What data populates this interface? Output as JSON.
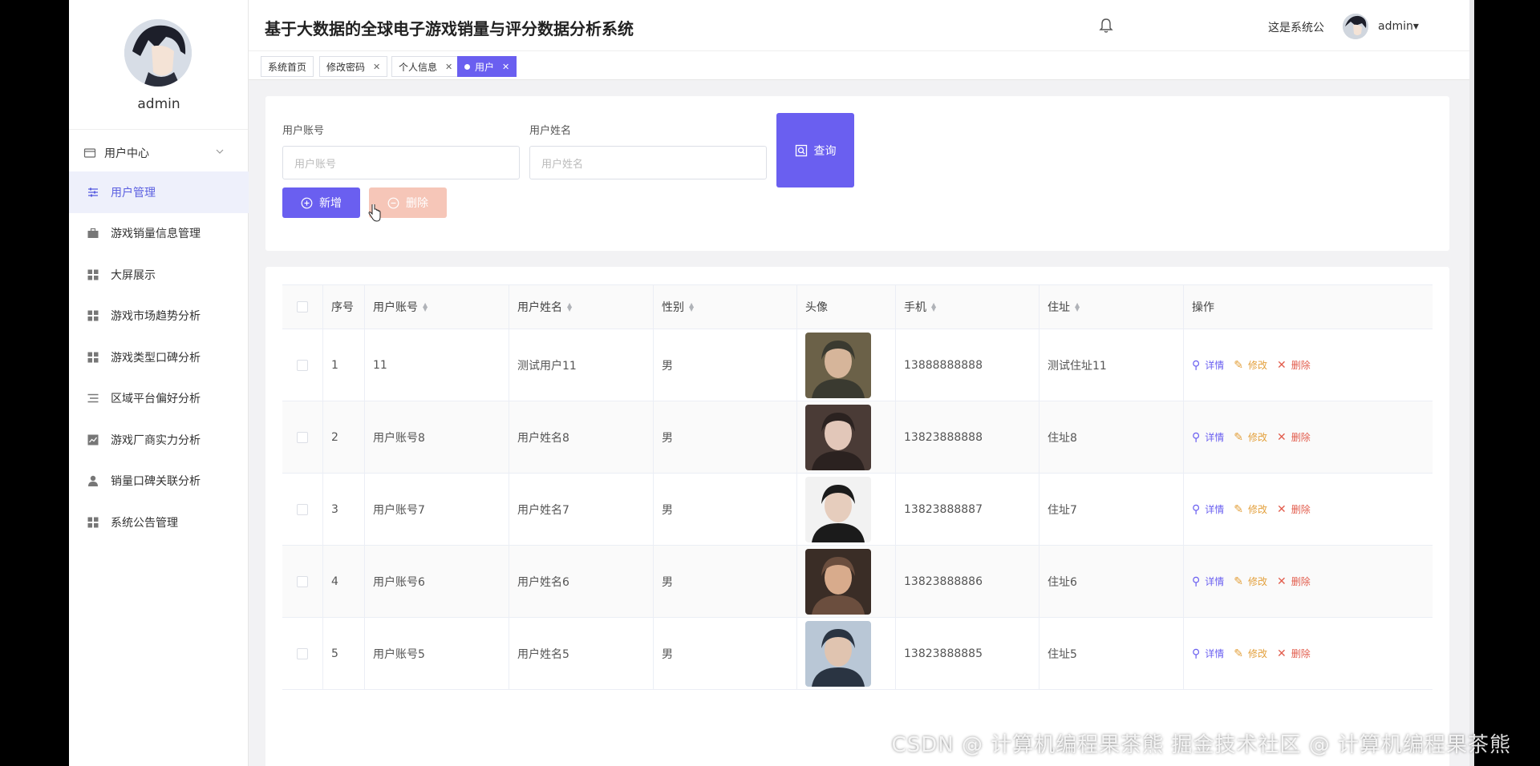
{
  "app": {
    "title": "基于大数据的全球电子游戏销量与评分数据分析系统"
  },
  "header": {
    "notice": "这是系统公",
    "user": "admin▾"
  },
  "sidebar": {
    "username": "admin",
    "group": "用户中心",
    "items": [
      {
        "label": "用户管理",
        "icon": "sliders-icon"
      },
      {
        "label": "游戏销量信息管理",
        "icon": "briefcase-icon"
      },
      {
        "label": "大屏展示",
        "icon": "grid-icon"
      },
      {
        "label": "游戏市场趋势分析",
        "icon": "grid-icon"
      },
      {
        "label": "游戏类型口碑分析",
        "icon": "grid-icon"
      },
      {
        "label": "区域平台偏好分析",
        "icon": "list-icon"
      },
      {
        "label": "游戏厂商实力分析",
        "icon": "chart-icon"
      },
      {
        "label": "销量口碑关联分析",
        "icon": "user-icon"
      },
      {
        "label": "系统公告管理",
        "icon": "grid-icon"
      }
    ]
  },
  "tabs": [
    {
      "label": "系统首页"
    },
    {
      "label": "修改密码"
    },
    {
      "label": "个人信息"
    },
    {
      "label": "用户"
    }
  ],
  "search": {
    "account_label": "用户账号",
    "account_placeholder": "用户账号",
    "name_label": "用户姓名",
    "name_placeholder": "用户姓名",
    "query_button": "查询",
    "add_button": "新增",
    "delete_button": "删除"
  },
  "table": {
    "columns": [
      "序号",
      "用户账号",
      "用户姓名",
      "性别",
      "头像",
      "手机",
      "住址",
      "操作"
    ],
    "actions": {
      "detail": "详情",
      "edit": "修改",
      "delete": "删除"
    },
    "rows": [
      {
        "index": "1",
        "account": "11",
        "name": "测试用户11",
        "gender": "男",
        "phone": "13888888888",
        "address": "测试住址11"
      },
      {
        "index": "2",
        "account": "用户账号8",
        "name": "用户姓名8",
        "gender": "男",
        "phone": "13823888888",
        "address": "住址8"
      },
      {
        "index": "3",
        "account": "用户账号7",
        "name": "用户姓名7",
        "gender": "男",
        "phone": "13823888887",
        "address": "住址7"
      },
      {
        "index": "4",
        "account": "用户账号6",
        "name": "用户姓名6",
        "gender": "男",
        "phone": "13823888886",
        "address": "住址6"
      },
      {
        "index": "5",
        "account": "用户账号5",
        "name": "用户姓名5",
        "gender": "男",
        "phone": "13823888885",
        "address": "住址5"
      }
    ]
  },
  "watermark": "CSDN @ 计算机编程果茶熊 掘金技术社区 @ 计算机编程果茶熊",
  "colors": {
    "primary": "#6a5ff0",
    "danger_light": "#f6c6b8",
    "edit": "#e3a03c",
    "delete": "#e25d4d"
  }
}
